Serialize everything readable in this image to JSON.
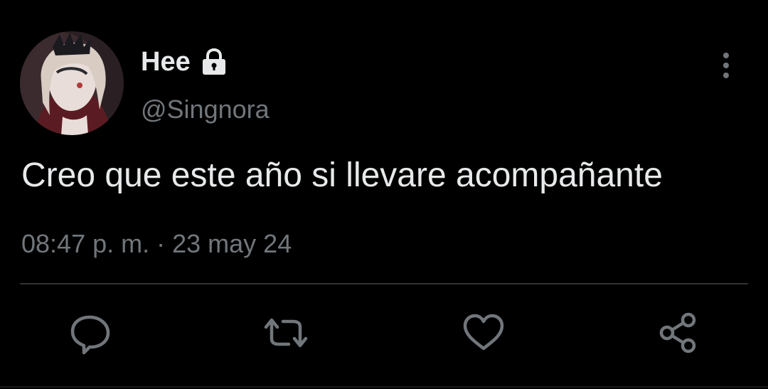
{
  "user": {
    "display_name": "Hee",
    "handle": "@Singnora",
    "protected_icon": "lock-icon",
    "avatar_icon": "avatar"
  },
  "tweet": {
    "text": "Creo que este año si llevare acompañante",
    "time": "08:47 p. m.",
    "separator": "·",
    "date": "23 may 24"
  },
  "actions": {
    "reply_icon": "reply-icon",
    "retweet_icon": "retweet-icon",
    "like_icon": "heart-icon",
    "share_icon": "share-icon",
    "more_icon": "more-vertical-icon"
  },
  "colors": {
    "background": "#000000",
    "primary_text": "#e7e9ea",
    "secondary_text": "#71767b",
    "divider": "#2f3336"
  }
}
